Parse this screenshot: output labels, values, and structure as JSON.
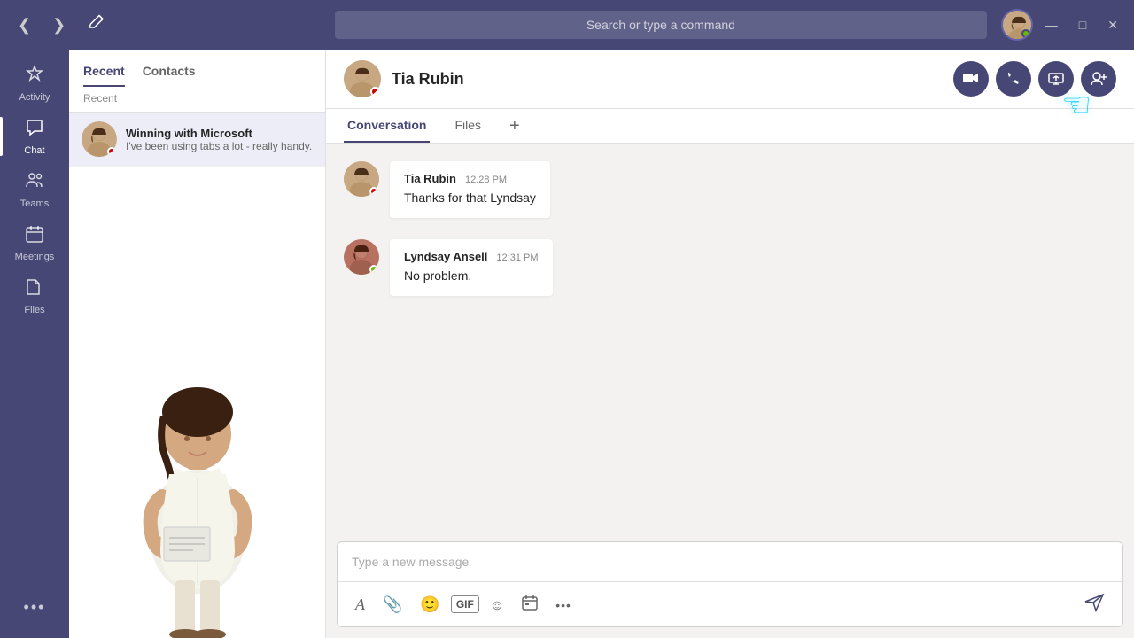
{
  "titlebar": {
    "search_placeholder": "Search or type a command",
    "nav_back": "‹",
    "nav_forward": "›"
  },
  "window_controls": {
    "minimize": "—",
    "maximize": "□",
    "close": "✕"
  },
  "sidebar": {
    "items": [
      {
        "id": "activity",
        "label": "Activity",
        "icon": "🔔",
        "badge": ""
      },
      {
        "id": "chat",
        "label": "Chat",
        "icon": "💬",
        "badge": ""
      },
      {
        "id": "teams",
        "label": "Teams",
        "icon": "👥",
        "badge": ""
      },
      {
        "id": "meetings",
        "label": "Meetings",
        "icon": "📅",
        "badge": ""
      },
      {
        "id": "files",
        "label": "Files",
        "icon": "📄",
        "badge": ""
      }
    ],
    "more_label": "...",
    "active": "chat"
  },
  "chat_panel": {
    "tabs": [
      {
        "id": "recent",
        "label": "Recent",
        "active": true
      },
      {
        "id": "contacts",
        "label": "Contacts",
        "active": false
      }
    ],
    "subtitle": "Recent",
    "items": [
      {
        "id": "1",
        "name": "Winning with Microsoft",
        "preview": "I've been using tabs a lot - really handy.",
        "status": "busy"
      }
    ]
  },
  "chat_main": {
    "contact_name": "Tia Rubin",
    "tabs": [
      {
        "id": "conversation",
        "label": "Conversation",
        "active": true
      },
      {
        "id": "files",
        "label": "Files",
        "active": false
      }
    ],
    "add_tab_label": "+",
    "messages": [
      {
        "id": "1",
        "sender": "Tia Rubin",
        "time": "12.28 PM",
        "text": "Thanks for that Lyndsay",
        "status": "busy"
      },
      {
        "id": "2",
        "sender": "Lyndsay Ansell",
        "time": "12:31 PM",
        "text": "No problem.",
        "status": "online"
      }
    ],
    "input_placeholder": "Type a new message",
    "actions": {
      "video_call": "📹",
      "audio_call": "📞",
      "screenshare": "🖥",
      "add_people": "👤+"
    }
  },
  "toolbar_buttons": [
    {
      "id": "format",
      "icon": "A",
      "label": "Format"
    },
    {
      "id": "attach",
      "icon": "📎",
      "label": "Attach"
    },
    {
      "id": "emoji",
      "icon": "🙂",
      "label": "Emoji"
    },
    {
      "id": "gif",
      "icon": "GIF",
      "label": "GIF"
    },
    {
      "id": "sticker",
      "icon": "☺",
      "label": "Sticker"
    },
    {
      "id": "schedule",
      "icon": "📋",
      "label": "Schedule"
    },
    {
      "id": "more",
      "icon": "•••",
      "label": "More options"
    }
  ],
  "colors": {
    "sidebar_bg": "#464775",
    "accent": "#464775",
    "active_tab": "#464775",
    "online": "#6bb700",
    "busy": "#cc0000"
  }
}
